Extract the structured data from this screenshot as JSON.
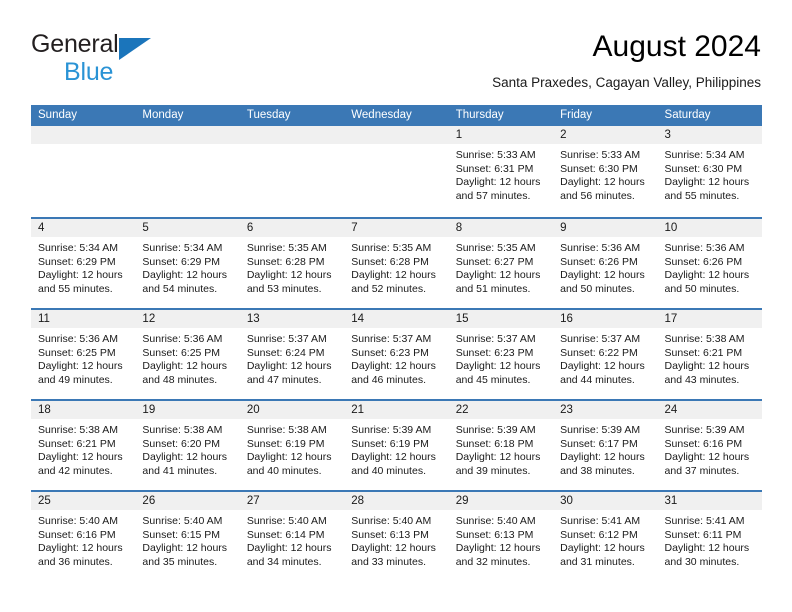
{
  "brand": {
    "line1": "General",
    "line2": "Blue",
    "triangle_color": "#1b75bb",
    "line2_color": "#2a93d5"
  },
  "header": {
    "month_title": "August 2024",
    "location": "Santa Praxedes, Cagayan Valley, Philippines"
  },
  "theme": {
    "header_blue": "#3b78b5",
    "date_band_gray": "#f0f0f0",
    "text_color": "#1a1a1a"
  },
  "calendar": {
    "weekday_headers": [
      "Sunday",
      "Monday",
      "Tuesday",
      "Wednesday",
      "Thursday",
      "Friday",
      "Saturday"
    ],
    "weeks": [
      [
        {
          "day": "",
          "empty": true
        },
        {
          "day": "",
          "empty": true
        },
        {
          "day": "",
          "empty": true
        },
        {
          "day": "",
          "empty": true
        },
        {
          "day": "1",
          "sunrise": "Sunrise: 5:33 AM",
          "sunset": "Sunset: 6:31 PM",
          "daylight": "Daylight: 12 hours and 57 minutes."
        },
        {
          "day": "2",
          "sunrise": "Sunrise: 5:33 AM",
          "sunset": "Sunset: 6:30 PM",
          "daylight": "Daylight: 12 hours and 56 minutes."
        },
        {
          "day": "3",
          "sunrise": "Sunrise: 5:34 AM",
          "sunset": "Sunset: 6:30 PM",
          "daylight": "Daylight: 12 hours and 55 minutes."
        }
      ],
      [
        {
          "day": "4",
          "sunrise": "Sunrise: 5:34 AM",
          "sunset": "Sunset: 6:29 PM",
          "daylight": "Daylight: 12 hours and 55 minutes."
        },
        {
          "day": "5",
          "sunrise": "Sunrise: 5:34 AM",
          "sunset": "Sunset: 6:29 PM",
          "daylight": "Daylight: 12 hours and 54 minutes."
        },
        {
          "day": "6",
          "sunrise": "Sunrise: 5:35 AM",
          "sunset": "Sunset: 6:28 PM",
          "daylight": "Daylight: 12 hours and 53 minutes."
        },
        {
          "day": "7",
          "sunrise": "Sunrise: 5:35 AM",
          "sunset": "Sunset: 6:28 PM",
          "daylight": "Daylight: 12 hours and 52 minutes."
        },
        {
          "day": "8",
          "sunrise": "Sunrise: 5:35 AM",
          "sunset": "Sunset: 6:27 PM",
          "daylight": "Daylight: 12 hours and 51 minutes."
        },
        {
          "day": "9",
          "sunrise": "Sunrise: 5:36 AM",
          "sunset": "Sunset: 6:26 PM",
          "daylight": "Daylight: 12 hours and 50 minutes."
        },
        {
          "day": "10",
          "sunrise": "Sunrise: 5:36 AM",
          "sunset": "Sunset: 6:26 PM",
          "daylight": "Daylight: 12 hours and 50 minutes."
        }
      ],
      [
        {
          "day": "11",
          "sunrise": "Sunrise: 5:36 AM",
          "sunset": "Sunset: 6:25 PM",
          "daylight": "Daylight: 12 hours and 49 minutes."
        },
        {
          "day": "12",
          "sunrise": "Sunrise: 5:36 AM",
          "sunset": "Sunset: 6:25 PM",
          "daylight": "Daylight: 12 hours and 48 minutes."
        },
        {
          "day": "13",
          "sunrise": "Sunrise: 5:37 AM",
          "sunset": "Sunset: 6:24 PM",
          "daylight": "Daylight: 12 hours and 47 minutes."
        },
        {
          "day": "14",
          "sunrise": "Sunrise: 5:37 AM",
          "sunset": "Sunset: 6:23 PM",
          "daylight": "Daylight: 12 hours and 46 minutes."
        },
        {
          "day": "15",
          "sunrise": "Sunrise: 5:37 AM",
          "sunset": "Sunset: 6:23 PM",
          "daylight": "Daylight: 12 hours and 45 minutes."
        },
        {
          "day": "16",
          "sunrise": "Sunrise: 5:37 AM",
          "sunset": "Sunset: 6:22 PM",
          "daylight": "Daylight: 12 hours and 44 minutes."
        },
        {
          "day": "17",
          "sunrise": "Sunrise: 5:38 AM",
          "sunset": "Sunset: 6:21 PM",
          "daylight": "Daylight: 12 hours and 43 minutes."
        }
      ],
      [
        {
          "day": "18",
          "sunrise": "Sunrise: 5:38 AM",
          "sunset": "Sunset: 6:21 PM",
          "daylight": "Daylight: 12 hours and 42 minutes."
        },
        {
          "day": "19",
          "sunrise": "Sunrise: 5:38 AM",
          "sunset": "Sunset: 6:20 PM",
          "daylight": "Daylight: 12 hours and 41 minutes."
        },
        {
          "day": "20",
          "sunrise": "Sunrise: 5:38 AM",
          "sunset": "Sunset: 6:19 PM",
          "daylight": "Daylight: 12 hours and 40 minutes."
        },
        {
          "day": "21",
          "sunrise": "Sunrise: 5:39 AM",
          "sunset": "Sunset: 6:19 PM",
          "daylight": "Daylight: 12 hours and 40 minutes."
        },
        {
          "day": "22",
          "sunrise": "Sunrise: 5:39 AM",
          "sunset": "Sunset: 6:18 PM",
          "daylight": "Daylight: 12 hours and 39 minutes."
        },
        {
          "day": "23",
          "sunrise": "Sunrise: 5:39 AM",
          "sunset": "Sunset: 6:17 PM",
          "daylight": "Daylight: 12 hours and 38 minutes."
        },
        {
          "day": "24",
          "sunrise": "Sunrise: 5:39 AM",
          "sunset": "Sunset: 6:16 PM",
          "daylight": "Daylight: 12 hours and 37 minutes."
        }
      ],
      [
        {
          "day": "25",
          "sunrise": "Sunrise: 5:40 AM",
          "sunset": "Sunset: 6:16 PM",
          "daylight": "Daylight: 12 hours and 36 minutes."
        },
        {
          "day": "26",
          "sunrise": "Sunrise: 5:40 AM",
          "sunset": "Sunset: 6:15 PM",
          "daylight": "Daylight: 12 hours and 35 minutes."
        },
        {
          "day": "27",
          "sunrise": "Sunrise: 5:40 AM",
          "sunset": "Sunset: 6:14 PM",
          "daylight": "Daylight: 12 hours and 34 minutes."
        },
        {
          "day": "28",
          "sunrise": "Sunrise: 5:40 AM",
          "sunset": "Sunset: 6:13 PM",
          "daylight": "Daylight: 12 hours and 33 minutes."
        },
        {
          "day": "29",
          "sunrise": "Sunrise: 5:40 AM",
          "sunset": "Sunset: 6:13 PM",
          "daylight": "Daylight: 12 hours and 32 minutes."
        },
        {
          "day": "30",
          "sunrise": "Sunrise: 5:41 AM",
          "sunset": "Sunset: 6:12 PM",
          "daylight": "Daylight: 12 hours and 31 minutes."
        },
        {
          "day": "31",
          "sunrise": "Sunrise: 5:41 AM",
          "sunset": "Sunset: 6:11 PM",
          "daylight": "Daylight: 12 hours and 30 minutes."
        }
      ]
    ]
  }
}
